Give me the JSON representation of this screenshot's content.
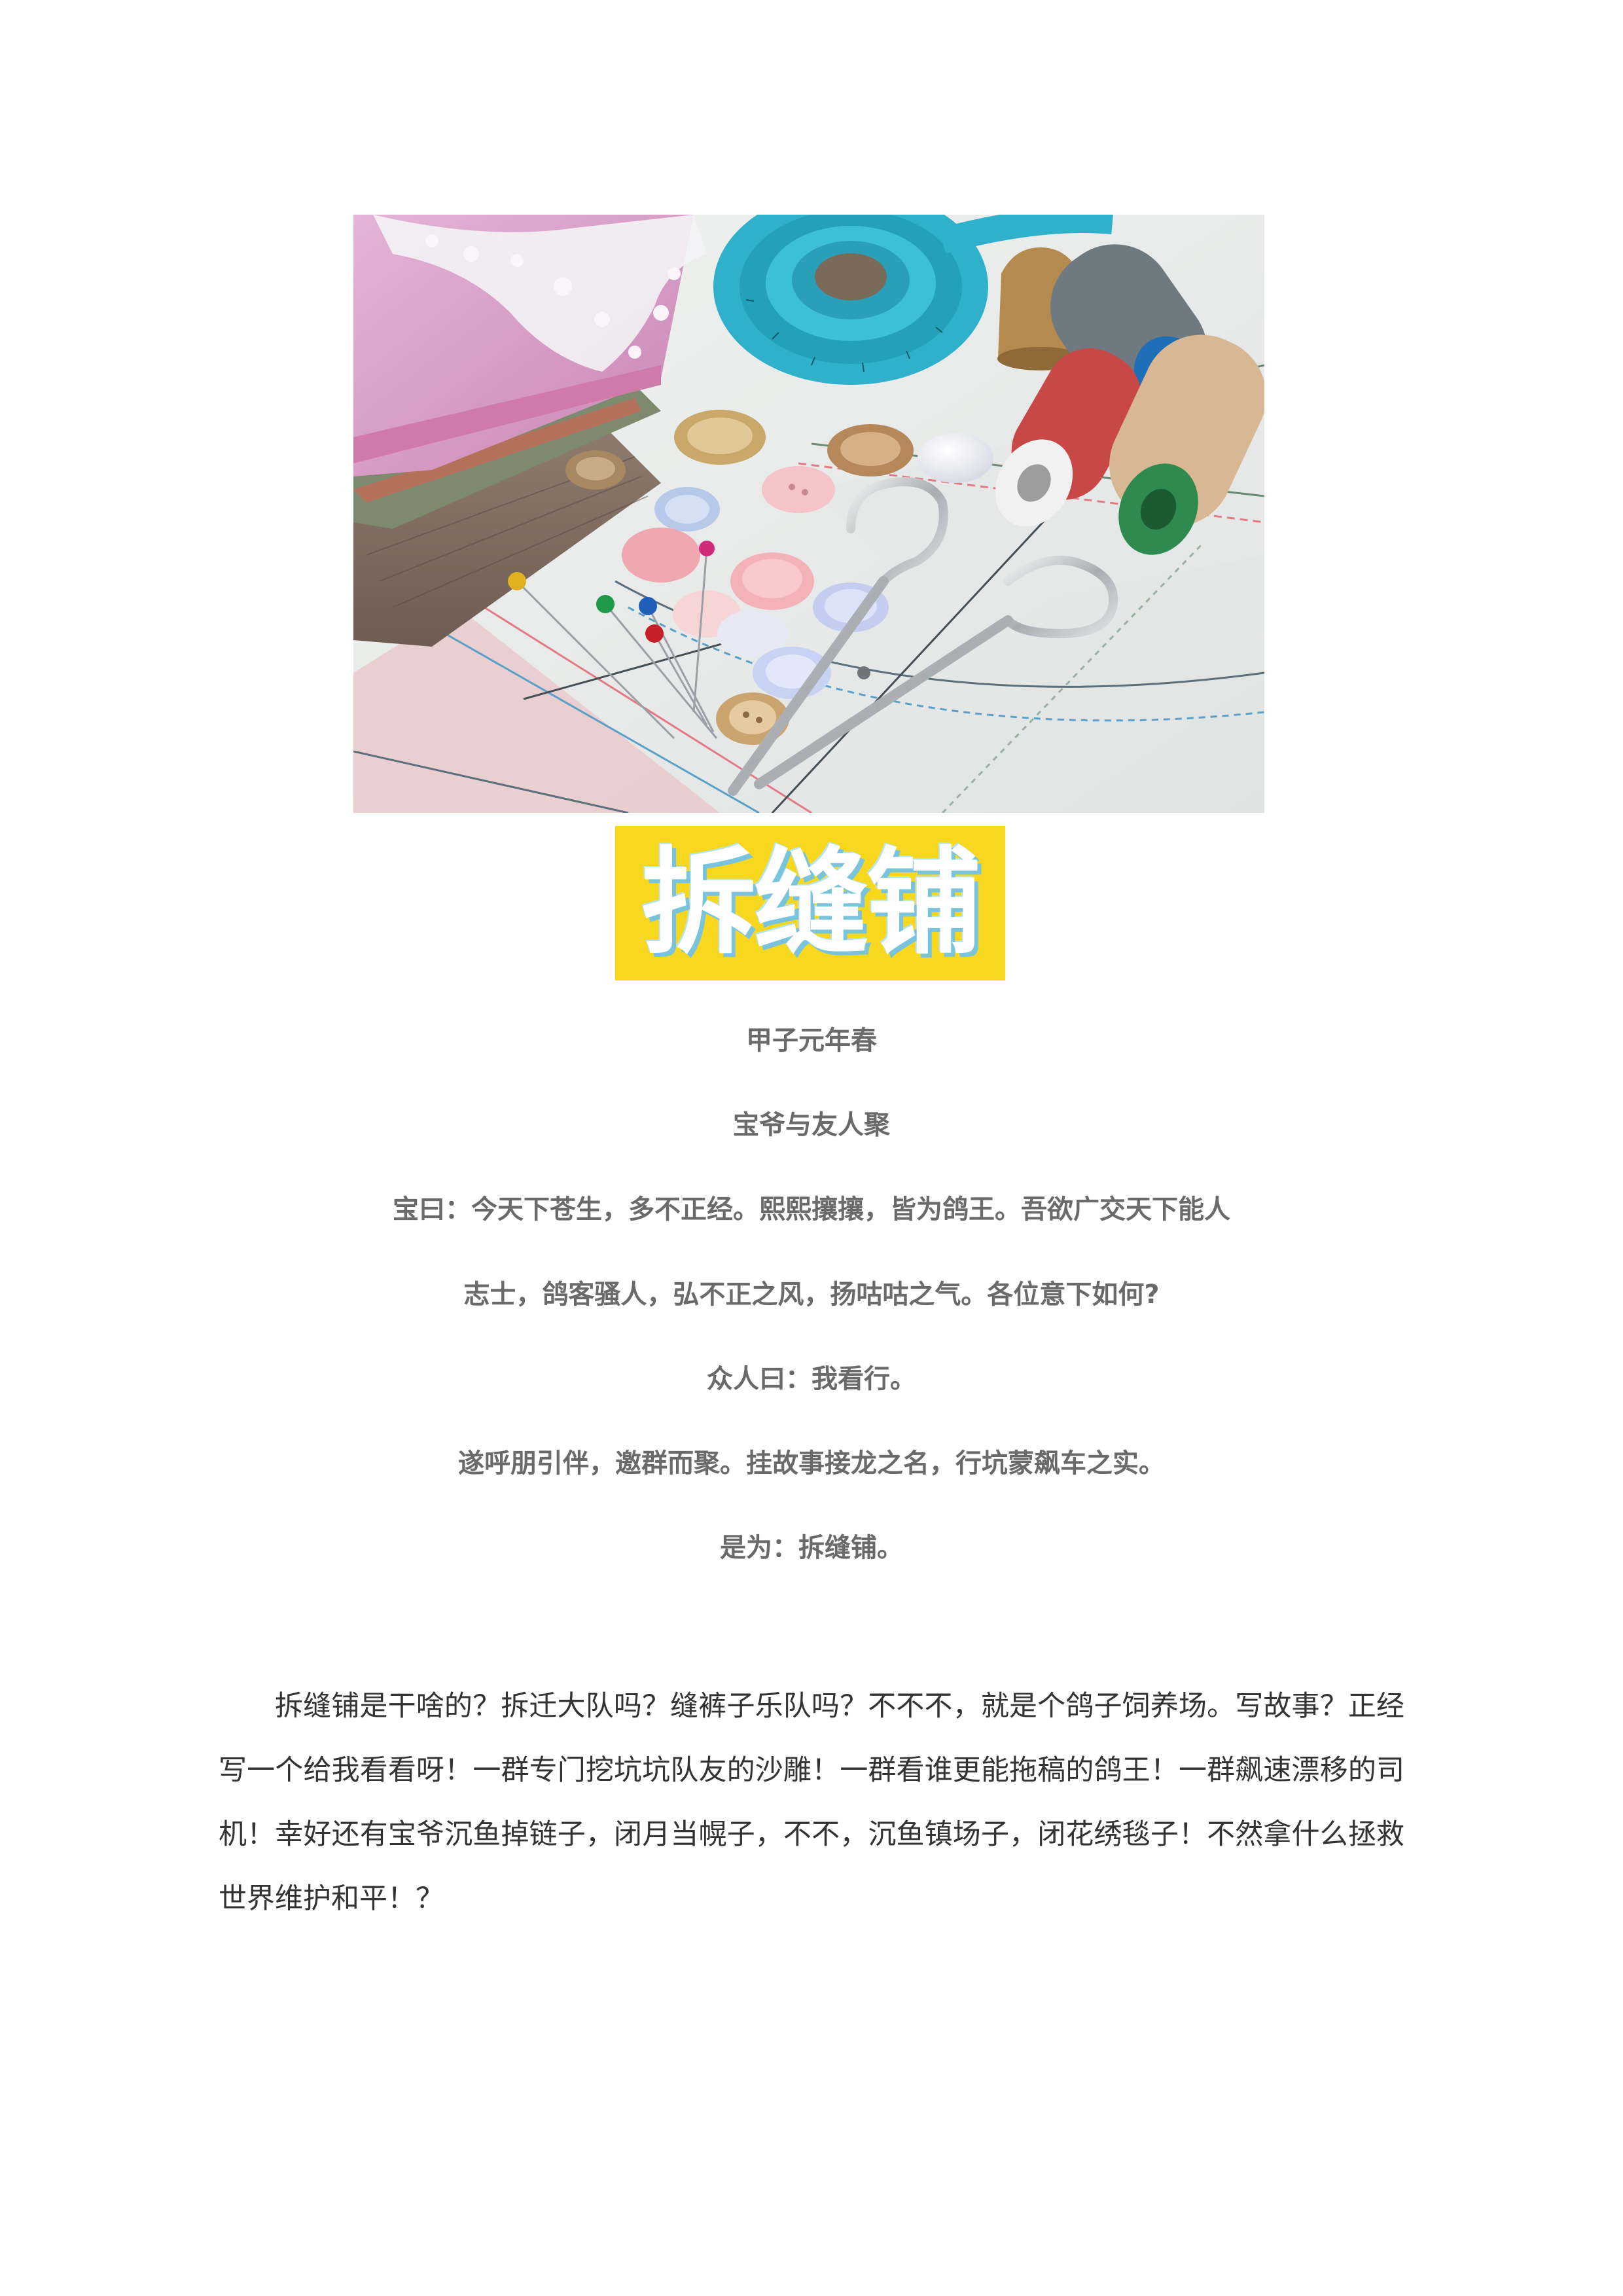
{
  "hero_image": {
    "icons": [
      "fabric",
      "lace",
      "tape-measure",
      "thread-spool",
      "thimble",
      "buttons",
      "pins",
      "scissors",
      "sewing-pattern"
    ],
    "colors": {
      "fabric_pink": "#d9a3c7",
      "tape_blue": "#2fb1cb",
      "thread_grey": "#6f7a80",
      "thread_red": "#c84848",
      "thread_beige": "#d8b894",
      "paper": "#e9ecea"
    }
  },
  "title": {
    "text": "拆缝铺",
    "bg_color": "#f8d81e"
  },
  "preface": [
    "甲子元年春",
    "宝爷与友人聚",
    "宝曰：今天下苍生，多不正经。熙熙攘攘，皆为鸽王。吾欲广交天下能人",
    "志士，鸽客骚人，弘不正之风，扬咕咕之气。各位意下如何?",
    "众人曰：我看行。",
    "遂呼朋引伴，邀群而聚。挂故事接龙之名，行坑蒙飙车之实。",
    "是为：拆缝铺。"
  ],
  "body": {
    "paragraph": "拆缝铺是干啥的？拆迁大队吗？缝裤子乐队吗？不不不，就是个鸽子饲养场。写故事？正经写一个给我看看呀！一群专门挖坑坑队友的沙雕！一群看谁更能拖稿的鸽王！一群飙速漂移的司机！幸好还有宝爷沉鱼掉链子，闭月当幌子，不不，沉鱼镇场子，闭花绣毯子！不然拿什么拯救世界维护和平！？"
  }
}
